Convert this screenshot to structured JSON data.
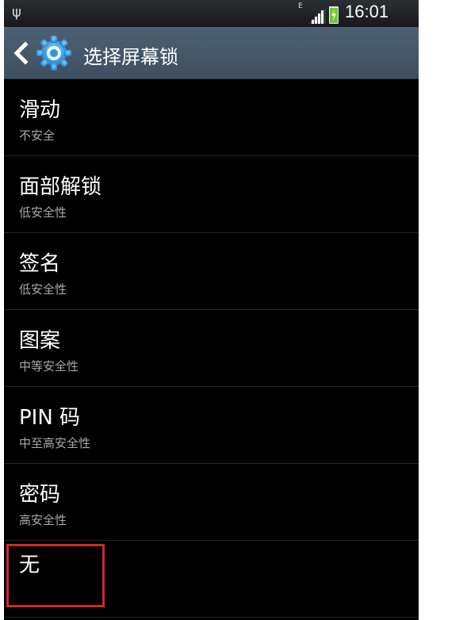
{
  "status_bar": {
    "usb_icon": "usb-icon",
    "network_type": "E",
    "time": "16:01",
    "battery_color": "#6cc83c"
  },
  "action_bar": {
    "title": "选择屏幕锁",
    "back_icon": "chevron-left-icon",
    "settings_icon": "gear-icon",
    "background": "#4e6173"
  },
  "options": [
    {
      "title": "滑动",
      "subtitle": "不安全"
    },
    {
      "title": "面部解锁",
      "subtitle": "低安全性"
    },
    {
      "title": "签名",
      "subtitle": "低安全性"
    },
    {
      "title": "图案",
      "subtitle": "中等安全性"
    },
    {
      "title": "PIN 码",
      "subtitle": "中至高安全性"
    },
    {
      "title": "密码",
      "subtitle": "高安全性"
    },
    {
      "title": "无",
      "subtitle": ""
    }
  ],
  "highlight_color": "#d4272a"
}
